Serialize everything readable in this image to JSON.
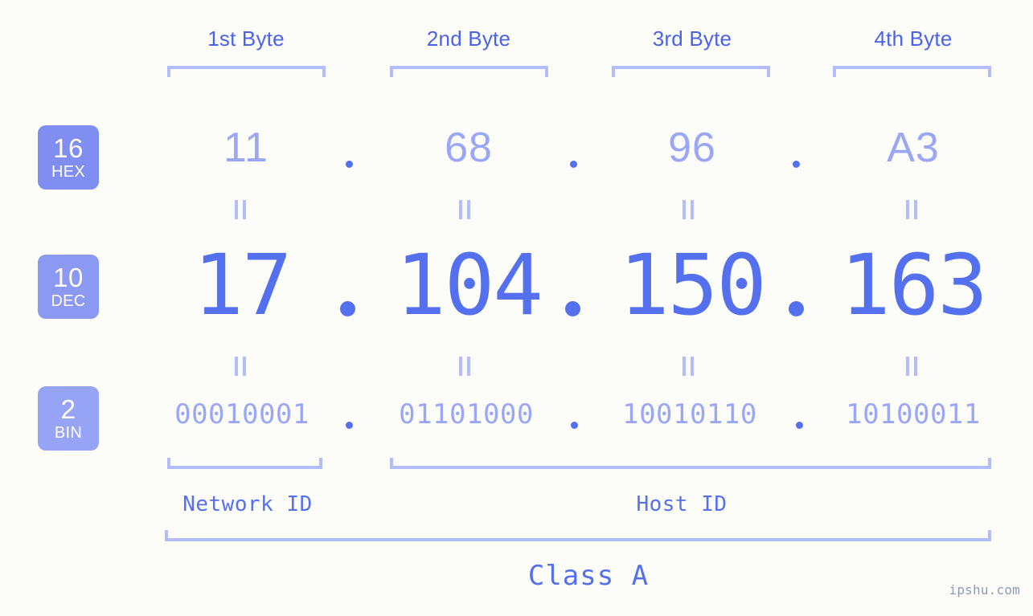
{
  "meta": {
    "background_color": "#fcfdf8",
    "accent_color": "#5470ee",
    "muted_accent_color": "#9aa6f7",
    "bracket_color": "#b4bdfb",
    "watermark": "ipshu.com"
  },
  "headers": [
    {
      "label": "1st Byte"
    },
    {
      "label": "2nd Byte"
    },
    {
      "label": "3rd Byte"
    },
    {
      "label": "4th Byte"
    }
  ],
  "bases": [
    {
      "number": "16",
      "name": "HEX",
      "color": "#7f8ef0"
    },
    {
      "number": "10",
      "name": "DEC",
      "color": "#8b99f2"
    },
    {
      "number": "2",
      "name": "BIN",
      "color": "#97a4f5"
    }
  ],
  "rows": {
    "hex": {
      "values": [
        "11",
        "68",
        "96",
        "A3"
      ],
      "separator": "."
    },
    "dec": {
      "values": [
        "17",
        "104",
        "150",
        "163"
      ],
      "separator": "."
    },
    "bin": {
      "values": [
        "00010001",
        "01101000",
        "10010110",
        "10100011"
      ],
      "separator": "."
    }
  },
  "connector_symbol": "||",
  "segments": {
    "network_id": "Network ID",
    "host_id": "Host ID"
  },
  "class": {
    "label": "Class A"
  },
  "ip": {
    "hex": "11.68.96.A3",
    "dec": "17.104.150.163",
    "bin": "00010001.01101000.10010110.10100011"
  }
}
